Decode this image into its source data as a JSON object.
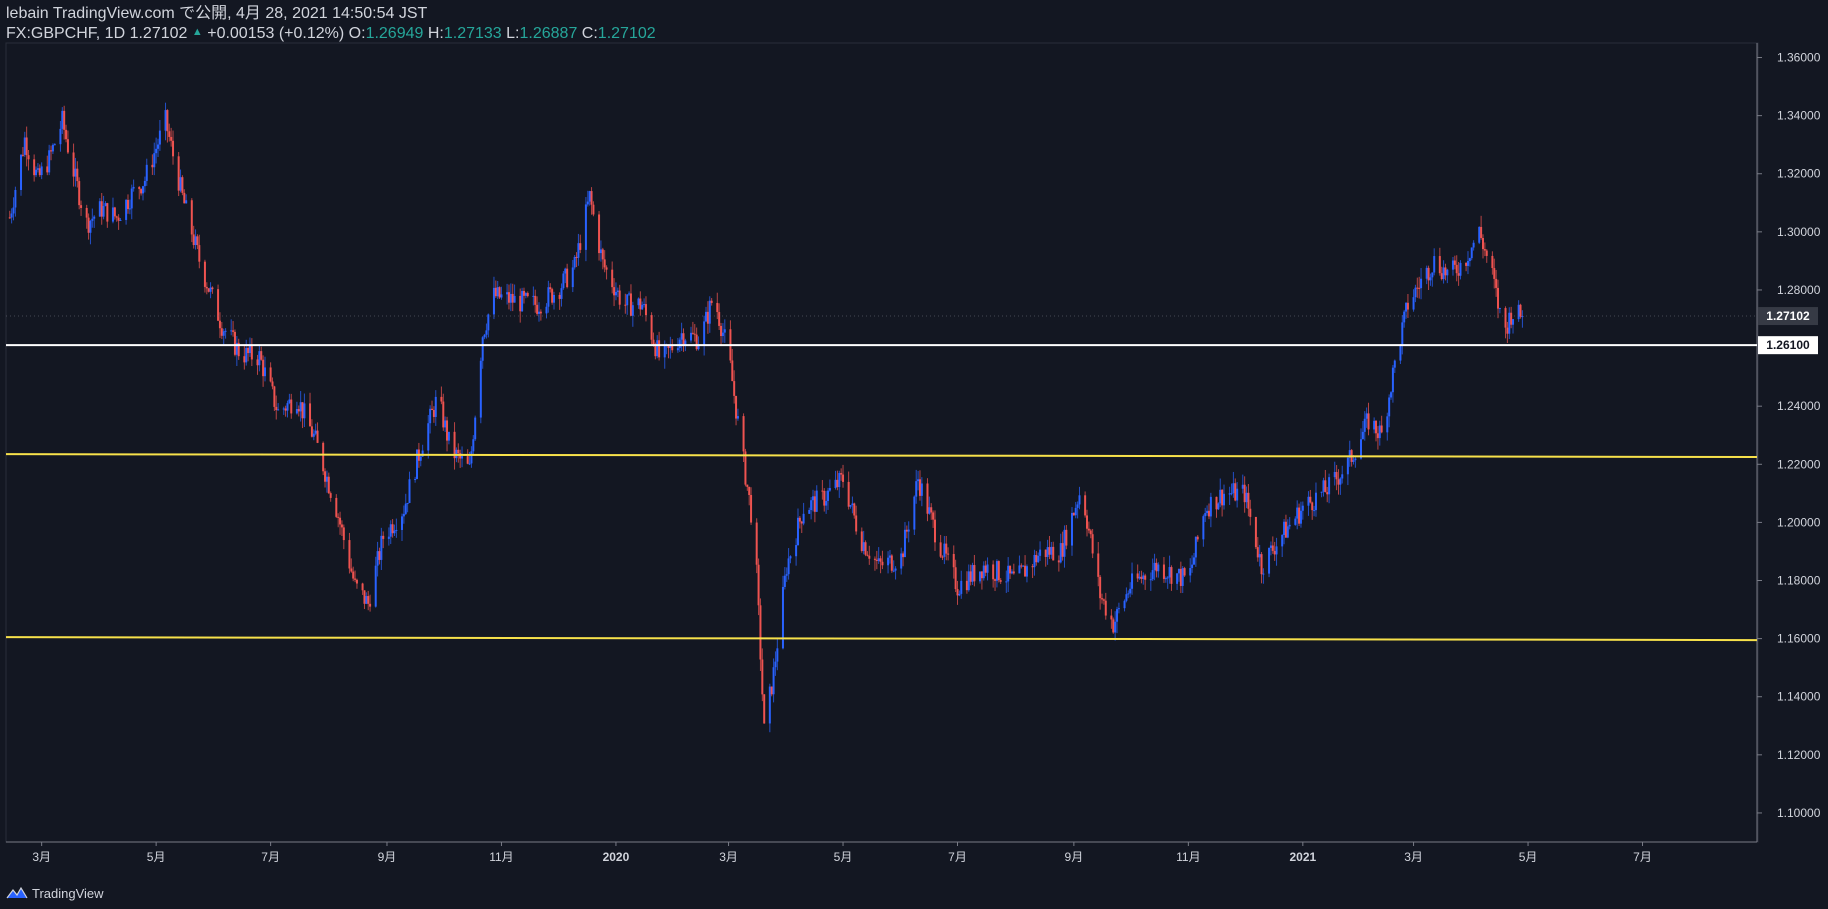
{
  "header": {
    "line1": "lebain TradingView.com で公開, 4月 28, 2021 14:50:54 JST",
    "symbol": "FX:GBPCHF, 1D 1.27102",
    "change_arrow": "▲",
    "change": "+0.00153 (+0.12%)",
    "o_label": "O:",
    "o_value": "1.26949",
    "h_label": "H:",
    "h_value": "1.27133",
    "l_label": "L:",
    "l_value": "1.26887",
    "c_label": "C:",
    "c_value": "1.27102"
  },
  "footer": {
    "brand": "TradingView",
    "icon": "tradingview-logo-icon"
  },
  "colors": {
    "background": "#131722",
    "up": "#2962ff",
    "down": "#ef5350",
    "support_white": "#ffffff",
    "support_yellow": "#f7e14b",
    "text": "#d1d4dc",
    "axis_border": "#2a2e39"
  },
  "chart_data": {
    "type": "candlestick",
    "symbol": "GBPCHF",
    "interval": "1D",
    "ylim": [
      1.09,
      1.365
    ],
    "y_ticks": [
      {
        "value": 1.36,
        "label": "1.36000"
      },
      {
        "value": 1.34,
        "label": "1.34000"
      },
      {
        "value": 1.32,
        "label": "1.32000"
      },
      {
        "value": 1.3,
        "label": "1.30000"
      },
      {
        "value": 1.28,
        "label": "1.28000"
      },
      {
        "value": 1.24,
        "label": "1.24000"
      },
      {
        "value": 1.22,
        "label": "1.22000"
      },
      {
        "value": 1.2,
        "label": "1.20000"
      },
      {
        "value": 1.18,
        "label": "1.18000"
      },
      {
        "value": 1.16,
        "label": "1.16000"
      },
      {
        "value": 1.14,
        "label": "1.14000"
      },
      {
        "value": 1.12,
        "label": "1.12000"
      },
      {
        "value": 1.1,
        "label": "1.10000"
      }
    ],
    "x_ticks": [
      {
        "date": "2019-03",
        "label": "3月",
        "bold": false
      },
      {
        "date": "2019-05",
        "label": "5月",
        "bold": false
      },
      {
        "date": "2019-07",
        "label": "7月",
        "bold": false
      },
      {
        "date": "2019-09",
        "label": "9月",
        "bold": false
      },
      {
        "date": "2019-11",
        "label": "11月",
        "bold": false
      },
      {
        "date": "2020-01",
        "label": "2020",
        "bold": true
      },
      {
        "date": "2020-03",
        "label": "3月",
        "bold": false
      },
      {
        "date": "2020-05",
        "label": "5月",
        "bold": false
      },
      {
        "date": "2020-07",
        "label": "7月",
        "bold": false
      },
      {
        "date": "2020-09",
        "label": "9月",
        "bold": false
      },
      {
        "date": "2020-11",
        "label": "11月",
        "bold": false
      },
      {
        "date": "2021-01",
        "label": "2021",
        "bold": true
      },
      {
        "date": "2021-03",
        "label": "3月",
        "bold": false
      },
      {
        "date": "2021-05",
        "label": "5月",
        "bold": false
      },
      {
        "date": "2021-07",
        "label": "7月",
        "bold": false
      }
    ],
    "horizontal_lines": [
      {
        "name": "white-support",
        "y_start": 1.261,
        "y_end": 1.261,
        "color": "#ffffff",
        "label": "1.26100"
      },
      {
        "name": "yellow-upper",
        "y_start": 1.2235,
        "y_end": 1.2225,
        "color": "#f7e14b",
        "label": ""
      },
      {
        "name": "yellow-lower",
        "y_start": 1.1605,
        "y_end": 1.1595,
        "color": "#f7e14b",
        "label": ""
      }
    ],
    "last_price": {
      "value": 1.27102,
      "label": "1.27102"
    },
    "price_path": [
      [
        "2019-02-12",
        1.305
      ],
      [
        "2019-02-20",
        1.332
      ],
      [
        "2019-02-27",
        1.318
      ],
      [
        "2019-03-05",
        1.325
      ],
      [
        "2019-03-12",
        1.338
      ],
      [
        "2019-03-19",
        1.318
      ],
      [
        "2019-03-25",
        1.303
      ],
      [
        "2019-04-02",
        1.308
      ],
      [
        "2019-04-10",
        1.305
      ],
      [
        "2019-04-18",
        1.313
      ],
      [
        "2019-04-25",
        1.318
      ],
      [
        "2019-05-06",
        1.338
      ],
      [
        "2019-05-15",
        1.312
      ],
      [
        "2019-05-25",
        1.288
      ],
      [
        "2019-06-05",
        1.268
      ],
      [
        "2019-06-15",
        1.258
      ],
      [
        "2019-06-25",
        1.257
      ],
      [
        "2019-07-05",
        1.238
      ],
      [
        "2019-07-15",
        1.243
      ],
      [
        "2019-07-25",
        1.228
      ],
      [
        "2019-08-05",
        1.205
      ],
      [
        "2019-08-15",
        1.178
      ],
      [
        "2019-08-22",
        1.172
      ],
      [
        "2019-08-30",
        1.195
      ],
      [
        "2019-09-10",
        1.205
      ],
      [
        "2019-09-20",
        1.228
      ],
      [
        "2019-09-28",
        1.243
      ],
      [
        "2019-10-05",
        1.225
      ],
      [
        "2019-10-15",
        1.218
      ],
      [
        "2019-10-22",
        1.265
      ],
      [
        "2019-10-28",
        1.278
      ],
      [
        "2019-11-10",
        1.276
      ],
      [
        "2019-11-20",
        1.275
      ],
      [
        "2019-12-01",
        1.28
      ],
      [
        "2019-12-10",
        1.288
      ],
      [
        "2019-12-18",
        1.312
      ],
      [
        "2019-12-25",
        1.289
      ],
      [
        "2020-01-05",
        1.275
      ],
      [
        "2020-01-15",
        1.275
      ],
      [
        "2020-01-25",
        1.255
      ],
      [
        "2020-02-05",
        1.265
      ],
      [
        "2020-02-15",
        1.263
      ],
      [
        "2020-02-22",
        1.278
      ],
      [
        "2020-03-01",
        1.258
      ],
      [
        "2020-03-08",
        1.225
      ],
      [
        "2020-03-15",
        1.195
      ],
      [
        "2020-03-20",
        1.128
      ],
      [
        "2020-03-25",
        1.148
      ],
      [
        "2020-04-01",
        1.185
      ],
      [
        "2020-04-10",
        1.205
      ],
      [
        "2020-04-20",
        1.208
      ],
      [
        "2020-05-01",
        1.215
      ],
      [
        "2020-05-10",
        1.195
      ],
      [
        "2020-05-20",
        1.185
      ],
      [
        "2020-06-01",
        1.188
      ],
      [
        "2020-06-10",
        1.215
      ],
      [
        "2020-06-20",
        1.195
      ],
      [
        "2020-07-01",
        1.178
      ],
      [
        "2020-07-15",
        1.185
      ],
      [
        "2020-08-01",
        1.18
      ],
      [
        "2020-08-15",
        1.19
      ],
      [
        "2020-08-25",
        1.19
      ],
      [
        "2020-09-05",
        1.212
      ],
      [
        "2020-09-15",
        1.175
      ],
      [
        "2020-09-22",
        1.165
      ],
      [
        "2020-10-01",
        1.178
      ],
      [
        "2020-10-15",
        1.185
      ],
      [
        "2020-11-01",
        1.18
      ],
      [
        "2020-11-10",
        1.205
      ],
      [
        "2020-11-20",
        1.21
      ],
      [
        "2020-12-01",
        1.21
      ],
      [
        "2020-12-10",
        1.185
      ],
      [
        "2020-12-20",
        1.195
      ],
      [
        "2021-01-01",
        1.205
      ],
      [
        "2021-01-15",
        1.212
      ],
      [
        "2021-01-25",
        1.22
      ],
      [
        "2021-02-05",
        1.235
      ],
      [
        "2021-02-12",
        1.23
      ],
      [
        "2021-02-20",
        1.258
      ],
      [
        "2021-02-26",
        1.275
      ],
      [
        "2021-03-05",
        1.283
      ],
      [
        "2021-03-12",
        1.29
      ],
      [
        "2021-03-20",
        1.285
      ],
      [
        "2021-03-28",
        1.29
      ],
      [
        "2021-04-05",
        1.3
      ],
      [
        "2021-04-12",
        1.285
      ],
      [
        "2021-04-18",
        1.265
      ],
      [
        "2021-04-22",
        1.272
      ],
      [
        "2021-04-28",
        1.271
      ]
    ]
  }
}
